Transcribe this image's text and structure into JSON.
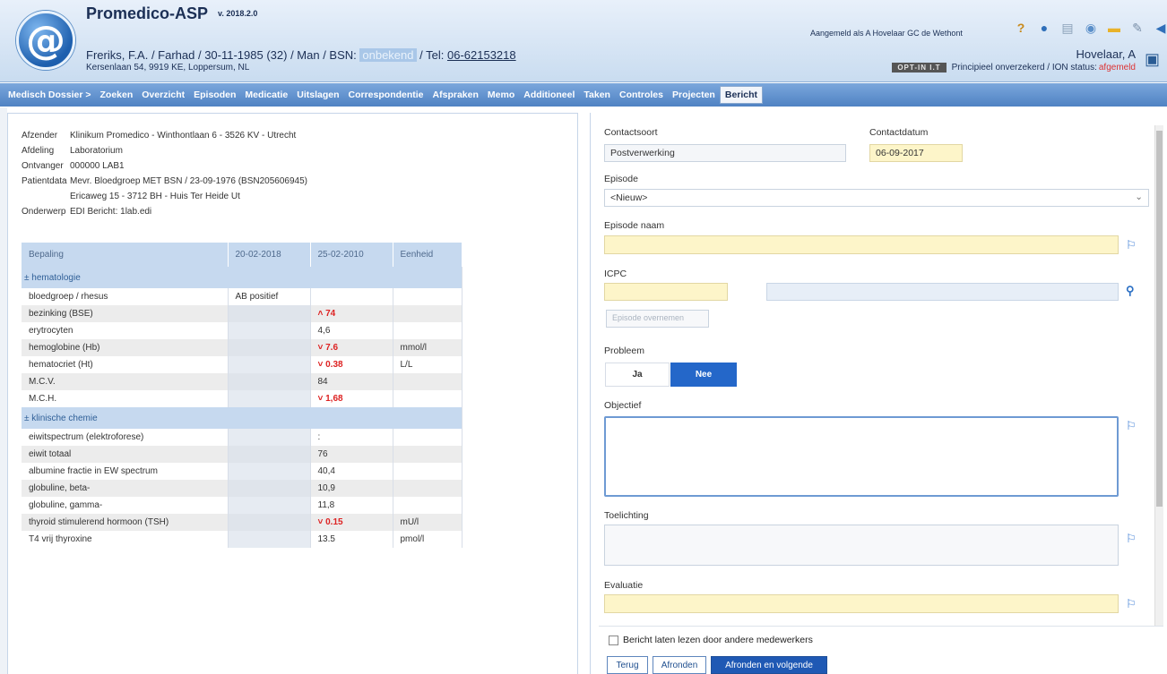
{
  "header": {
    "app_title": "Promedico-ASP",
    "version": "v. 2018.2.0",
    "patient_prefix": "Freriks, F.A. / Farhad / 30-11-1985 (32) / Man / BSN:",
    "bsn_value": "onbekend",
    "tel_prefix": "/ Tel:",
    "tel_value": "06-62153218",
    "address": "Kersenlaan 54, 9919 KE, Loppersum, NL",
    "login_text": "Aangemeld als A Hovelaar  GC de Wethont",
    "user_name": "Hovelaar, A",
    "opt_badge": "OPT-IN I.T",
    "insurance_text": "Principieel onverzekerd / ION status:",
    "ion_status": "afgemeld",
    "icons": [
      "help-icon",
      "info-icon",
      "notes-icon",
      "globe-icon",
      "folder-icon",
      "signature-icon",
      "logout-icon"
    ]
  },
  "nav": {
    "items": [
      "Medisch Dossier >",
      "Zoeken",
      "Overzicht",
      "Episoden",
      "Medicatie",
      "Uitslagen",
      "Correspondentie",
      "Afspraken",
      "Memo",
      "Additioneel",
      "Taken",
      "Controles",
      "Projecten",
      "Bericht"
    ],
    "active": "Bericht"
  },
  "message": {
    "afzender_label": "Afzender",
    "afzender": "Klinikum Promedico - Winthontlaan 6 - 3526 KV - Utrecht",
    "afdeling_label": "Afdeling",
    "afdeling": "Laboratorium",
    "ontvanger_label": "Ontvanger",
    "ontvanger": "000000 LAB1",
    "patientdata_label": "Patientdata",
    "patientdata_1": "Mevr. Bloedgroep MET BSN / 23-09-1976 (BSN205606945)",
    "patientdata_2": "Ericaweg 15 - 3712 BH - Huis Ter Heide Ut",
    "onderwerp_label": "Onderwerp",
    "onderwerp": "EDI Bericht: 1lab.edi"
  },
  "lab": {
    "headers": [
      "Bepaling",
      "20-02-2018",
      "25-02-2010",
      "Eenheid"
    ],
    "categories": [
      {
        "name": "± hematologie",
        "rows": [
          {
            "test": "bloedgroep / rhesus",
            "v1": "AB positief",
            "v2": "",
            "unit": "",
            "flag": ""
          },
          {
            "test": "bezinking (BSE)",
            "v1": "",
            "v2": "74",
            "unit": "",
            "flag": "^"
          },
          {
            "test": "erytrocyten",
            "v1": "",
            "v2": "4,6",
            "unit": "",
            "flag": ""
          },
          {
            "test": "hemoglobine (Hb)",
            "v1": "",
            "v2": "7.6",
            "unit": "mmol/l",
            "flag": "v"
          },
          {
            "test": "hematocriet (Ht)",
            "v1": "",
            "v2": "0.38",
            "unit": "L/L",
            "flag": "v"
          },
          {
            "test": "M.C.V.",
            "v1": "",
            "v2": "84",
            "unit": "",
            "flag": ""
          },
          {
            "test": "M.C.H.",
            "v1": "",
            "v2": "1,68",
            "unit": "",
            "flag": "v"
          }
        ]
      },
      {
        "name": "± klinische chemie",
        "rows": [
          {
            "test": "eiwitspectrum (elektroforese)",
            "v1": "",
            "v2": ":",
            "unit": "",
            "flag": ""
          },
          {
            "test": "eiwit totaal",
            "v1": "",
            "v2": "76",
            "unit": "",
            "flag": ""
          },
          {
            "test": "albumine fractie in EW spectrum",
            "v1": "",
            "v2": "40,4",
            "unit": "",
            "flag": ""
          },
          {
            "test": "globuline, beta-",
            "v1": "",
            "v2": "10,9",
            "unit": "",
            "flag": ""
          },
          {
            "test": "globuline, gamma-",
            "v1": "",
            "v2": "11,8",
            "unit": "",
            "flag": ""
          },
          {
            "test": "thyroid stimulerend hormoon (TSH)",
            "v1": "",
            "v2": "0.15",
            "unit": "mU/l",
            "flag": "v"
          },
          {
            "test": "T4 vrij thyroxine",
            "v1": "",
            "v2": "13.5",
            "unit": "pmol/l",
            "flag": ""
          }
        ]
      }
    ]
  },
  "form": {
    "contactsoort_label": "Contactsoort",
    "contactsoort": "Postverwerking",
    "contactdatum_label": "Contactdatum",
    "contactdatum": "06-09-2017",
    "episode_label": "Episode",
    "episode": "<Nieuw>",
    "episode_naam_label": "Episode naam",
    "icpc_label": "ICPC",
    "episode_overnemen": "Episode overnemen",
    "probleem_label": "Probleem",
    "ja": "Ja",
    "nee": "Nee",
    "objectief_label": "Objectief",
    "toelichting_label": "Toelichting",
    "evaluatie_label": "Evaluatie",
    "checkbox_label": "Bericht laten lezen door andere medewerkers",
    "btn_terug": "Terug",
    "btn_afronden": "Afronden",
    "btn_afronden_volgende": "Afronden en volgende"
  },
  "colors": {
    "nav_bg": "#5a8ccb",
    "header_bg": "#d4e3f4",
    "abnormal": "#dd2222",
    "required_field": "#fdf5c9",
    "primary_button": "#1f59b4"
  }
}
